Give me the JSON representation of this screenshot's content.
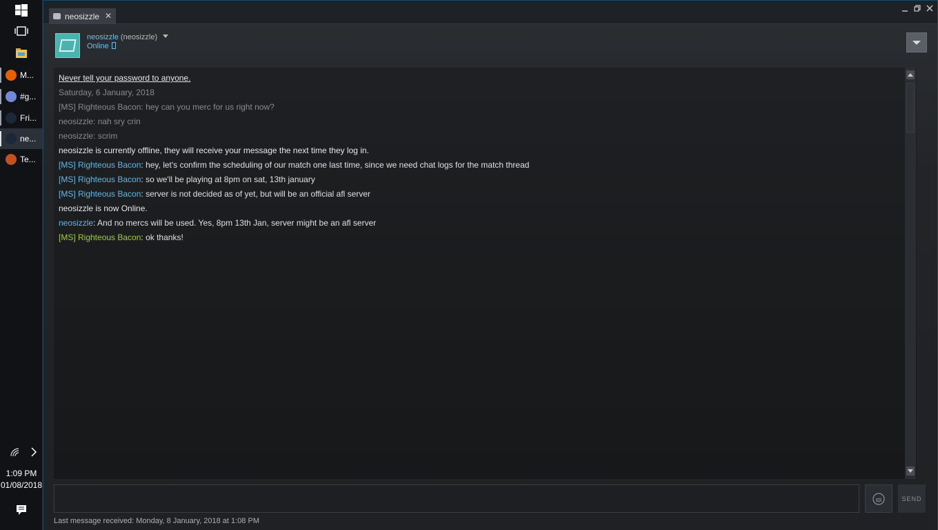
{
  "taskbar": {
    "apps": [
      {
        "label": "M...",
        "icon": "firefox-icon",
        "color": "#e66000",
        "running": true,
        "active": false
      },
      {
        "label": "#g...",
        "icon": "discord-icon",
        "color": "#7289da",
        "running": true,
        "active": false
      },
      {
        "label": "Fri...",
        "icon": "steam-icon",
        "color": "#1b2838",
        "running": true,
        "active": false
      },
      {
        "label": "ne...",
        "icon": "steam-icon",
        "color": "#1b2838",
        "running": true,
        "active": true
      },
      {
        "label": "Te...",
        "icon": "tf2-icon",
        "color": "#c1521f",
        "running": false,
        "active": false
      }
    ],
    "time": "1:09 PM",
    "date": "01/08/2018"
  },
  "window": {
    "tab_title": "neosizzle"
  },
  "friend": {
    "name": "neosizzle",
    "alias": "(neosizzle)",
    "status": "Online"
  },
  "chat": {
    "lines": [
      {
        "kind": "warn",
        "text": "Never tell your password to anyone."
      },
      {
        "kind": "old",
        "text": "Saturday, 6 January, 2018"
      },
      {
        "kind": "old",
        "text": "[MS] Righteous Bacon: hey can you merc for us right now?"
      },
      {
        "kind": "old",
        "text": "neosizzle: nah sry crin"
      },
      {
        "kind": "old",
        "text": "neosizzle: scrim"
      },
      {
        "kind": "sys",
        "text": "neosizzle is currently offline, they will receive your message the next time they log in."
      },
      {
        "kind": "msg",
        "speaker": "[MS] Righteous Bacon",
        "speaker_color": "blue",
        "text": ": hey, let's confirm the scheduling of our match one last time, since we need chat logs for the match thread"
      },
      {
        "kind": "msg",
        "speaker": "[MS] Righteous Bacon",
        "speaker_color": "blue",
        "text": ": so we'll be playing at 8pm on sat, 13th january"
      },
      {
        "kind": "msg",
        "speaker": "[MS] Righteous Bacon",
        "speaker_color": "blue",
        "text": ": server is not decided as of yet, but will be an official afl server"
      },
      {
        "kind": "sys",
        "text": "neosizzle is now Online."
      },
      {
        "kind": "msg",
        "speaker": "neosizzle",
        "speaker_color": "blue",
        "text": ": And no mercs will be used. Yes, 8pm 13th Jan, server might be an afl server"
      },
      {
        "kind": "msg",
        "speaker": "[MS] Righteous Bacon",
        "speaker_color": "green",
        "text": ": ok thanks!"
      }
    ],
    "input_value": "",
    "send_label": "SEND",
    "last_message": "Last message received: Monday, 8 January, 2018 at 1:08 PM"
  }
}
